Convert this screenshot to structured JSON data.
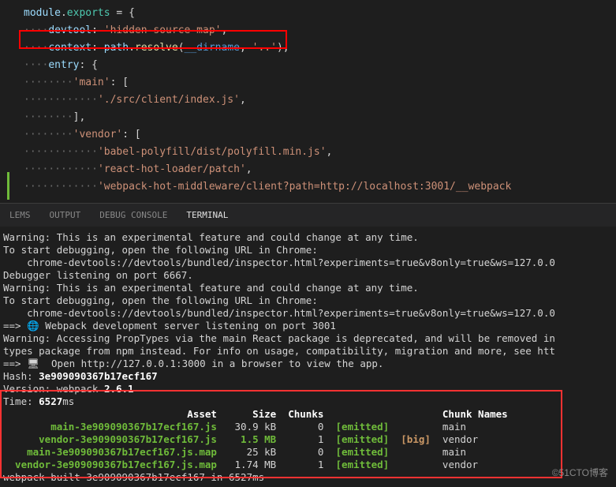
{
  "editor": {
    "lines": [
      {
        "indent": 0,
        "segments": [
          {
            "t": "module",
            "c": "kw-var"
          },
          {
            "t": ".",
            "c": "op"
          },
          {
            "t": "exports",
            "c": "kw-prop"
          },
          {
            "t": " = {",
            "c": "op"
          }
        ]
      },
      {
        "indent": 1,
        "segments": [
          {
            "t": "devtool",
            "c": "num-prop"
          },
          {
            "t": ": ",
            "c": "op"
          },
          {
            "t": "'hidden-source-map'",
            "c": "str"
          },
          {
            "t": ",",
            "c": "op"
          }
        ]
      },
      {
        "indent": 1,
        "segments": [
          {
            "t": "context",
            "c": "num-prop"
          },
          {
            "t": ": ",
            "c": "op"
          },
          {
            "t": "path",
            "c": "kw-var"
          },
          {
            "t": ".",
            "c": "op"
          },
          {
            "t": "resolve",
            "c": "obj"
          },
          {
            "t": "(",
            "c": "op"
          },
          {
            "t": "__dirname",
            "c": "param"
          },
          {
            "t": ", ",
            "c": "op"
          },
          {
            "t": "'..'",
            "c": "str"
          },
          {
            "t": "),",
            "c": "op"
          }
        ]
      },
      {
        "indent": 1,
        "segments": [
          {
            "t": "entry",
            "c": "num-prop"
          },
          {
            "t": ": {",
            "c": "op"
          }
        ]
      },
      {
        "indent": 2,
        "segments": [
          {
            "t": "'main'",
            "c": "str"
          },
          {
            "t": ": [",
            "c": "op"
          }
        ]
      },
      {
        "indent": 3,
        "segments": [
          {
            "t": "'./src/client/index.js'",
            "c": "str"
          },
          {
            "t": ",",
            "c": "op"
          }
        ]
      },
      {
        "indent": 2,
        "segments": [
          {
            "t": "],",
            "c": "op"
          }
        ]
      },
      {
        "indent": 2,
        "segments": [
          {
            "t": "'vendor'",
            "c": "str"
          },
          {
            "t": ": [",
            "c": "op"
          }
        ]
      },
      {
        "indent": 3,
        "segments": [
          {
            "t": "'babel-polyfill/dist/polyfill.min.js'",
            "c": "str"
          },
          {
            "t": ",",
            "c": "op"
          }
        ]
      },
      {
        "indent": 3,
        "segments": [
          {
            "t": "'react-hot-loader/patch'",
            "c": "str"
          },
          {
            "t": ",",
            "c": "op"
          }
        ]
      },
      {
        "indent": 3,
        "segments": [
          {
            "t": "'webpack-hot-middleware/client?path=http://localhost:3001/__webpack",
            "c": "str"
          }
        ]
      }
    ]
  },
  "tabs": {
    "items": [
      "LEMS",
      "OUTPUT",
      "DEBUG CONSOLE",
      "TERMINAL"
    ],
    "active": 3
  },
  "terminal": {
    "pre_lines": [
      "Warning: This is an experimental feature and could change at any time.",
      "To start debugging, open the following URL in Chrome:",
      "    chrome-devtools://devtools/bundled/inspector.html?experiments=true&v8only=true&ws=127.0.0",
      "Debugger listening on port 6667.",
      "Warning: This is an experimental feature and could change at any time.",
      "To start debugging, open the following URL in Chrome:",
      "    chrome-devtools://devtools/bundled/inspector.html?experiments=true&v8only=true&ws=127.0.0",
      "==> 🌐 Webpack development server listening on port 3001",
      "Warning: Accessing PropTypes via the main React package is deprecated, and will be removed in",
      "types package from npm instead. For info on usage, compatibility, migration and more, see htt",
      "==> 🖥  Open http://127.0.0.1:3000 in a browser to view the app."
    ],
    "hash_label": "Hash: ",
    "hash": "3e909090367b17ecf167",
    "version_label": "Version: webpack ",
    "version": "2.6.1",
    "time_label": "Time: ",
    "time": "6527",
    "time_unit": "ms",
    "headers": {
      "asset": "Asset",
      "size": "Size",
      "chunks": "Chunks",
      "chunk_names": "Chunk Names"
    },
    "rows": [
      {
        "asset": "main-3e909090367b17ecf167.js",
        "size": "30.9 kB",
        "chunks": "0",
        "emitted": "[emitted]",
        "big": "",
        "name": "main",
        "sizeBig": false
      },
      {
        "asset": "vendor-3e909090367b17ecf167.js",
        "size": "1.5 MB",
        "chunks": "1",
        "emitted": "[emitted]",
        "big": "[big]",
        "name": "vendor",
        "sizeBig": true
      },
      {
        "asset": "main-3e909090367b17ecf167.js.map",
        "size": "25 kB",
        "chunks": "0",
        "emitted": "[emitted]",
        "big": "",
        "name": "main",
        "sizeBig": false
      },
      {
        "asset": "vendor-3e909090367b17ecf167.js.map",
        "size": "1.74 MB",
        "chunks": "1",
        "emitted": "[emitted]",
        "big": "",
        "name": "vendor",
        "sizeBig": false
      }
    ],
    "footer": "webpack built 3e909090367b17ecf167 in 6527ms"
  },
  "watermark": "©51CTO博客"
}
